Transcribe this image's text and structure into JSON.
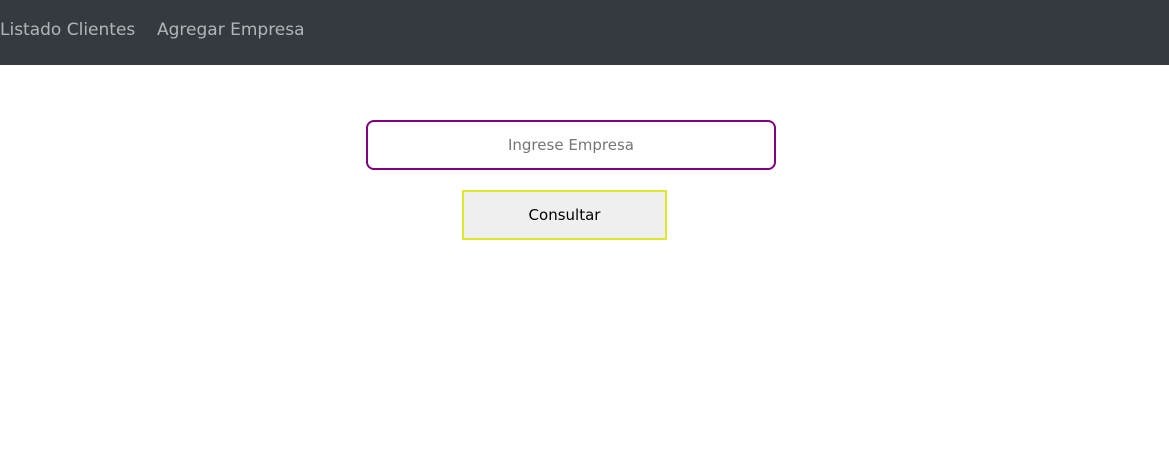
{
  "navbar": {
    "links": [
      {
        "label": "Listado Clientes"
      },
      {
        "label": "Agregar Empresa"
      }
    ]
  },
  "form": {
    "company_input": {
      "value": "",
      "placeholder": "Ingrese Empresa"
    },
    "consult_button_label": "Consultar"
  },
  "colors": {
    "navbar_bg": "#343a40",
    "input_border": "#800080",
    "button_border": "#e0e629",
    "button_bg": "#efefef"
  }
}
